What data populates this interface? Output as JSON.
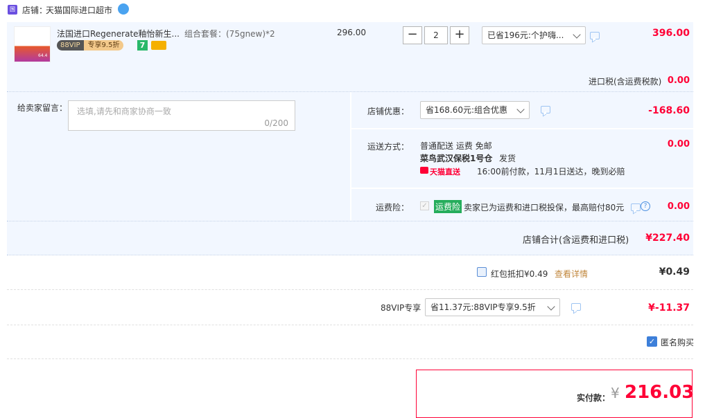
{
  "shop": {
    "label": "店铺：",
    "name": "天猫国际进口超市",
    "badge": "国际"
  },
  "item": {
    "title": "法国进口Regenerate釉怡新生...",
    "spec": "组合套餐：(75gnew)*2",
    "unit_price": "296.00",
    "qty": "2",
    "minus": "−",
    "plus": "+",
    "vip_tag": "88VIP",
    "vip_discount": "专享9.5折",
    "seven_tag": "7",
    "promo_select": "已省196元:个护嗨...",
    "subtotal": "396.00",
    "thumb_price": "64.4"
  },
  "tax": {
    "label": "进口税(含运费税款)",
    "value": "0.00"
  },
  "message": {
    "label": "给卖家留言：",
    "placeholder": "选填,请先和商家协商一致",
    "counter": "0/200"
  },
  "shop_discount": {
    "label": "店铺优惠：",
    "select": "省168.60元:组合优惠",
    "value": "-168.60"
  },
  "shipping": {
    "label": "运送方式：",
    "line1": "普通配送 运费 免邮",
    "warehouse": "菜鸟武汉保税1号仓",
    "warehouse_suffix": "发货",
    "tmall_direct": "天猫直送",
    "promise": "16:00前付款，11月1日送达，晚到必赔",
    "value": "0.00"
  },
  "insurance": {
    "label": "运费险：",
    "tag": "运费险",
    "desc": "卖家已为运费和进口税投保，最高赔付80元",
    "value": "0.00"
  },
  "shop_total": {
    "label": "店铺合计(含运费和进口税)",
    "value": "¥227.40"
  },
  "redpacket": {
    "label": "红包抵扣¥0.49",
    "link": "查看详情",
    "value": "¥0.49"
  },
  "vip": {
    "label": "88VIP专享",
    "select": "省11.37元:88VIP专享9.5折",
    "value": "¥-11.37"
  },
  "anonymous": {
    "label": "匿名购买"
  },
  "payment": {
    "label": "实付款：",
    "currency": "¥",
    "amount": "216.03"
  },
  "colors": {
    "accent": "#ff0036",
    "link": "#3c6fc2",
    "bluebg": "#f2f7ff",
    "green": "#26ad5c"
  }
}
